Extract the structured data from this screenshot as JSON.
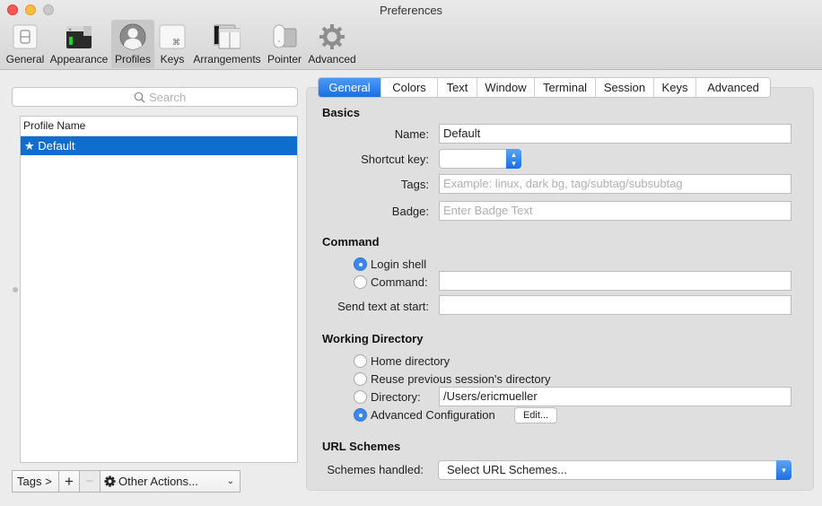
{
  "window": {
    "title": "Preferences"
  },
  "toolbar": {
    "items": [
      {
        "label": "General",
        "icon": "toggle-switch-icon"
      },
      {
        "label": "Appearance",
        "icon": "terminal-window-icon"
      },
      {
        "label": "Profiles",
        "icon": "user-silhouette-icon",
        "active": true
      },
      {
        "label": "Keys",
        "icon": "command-key-icon"
      },
      {
        "label": "Arrangements",
        "icon": "window-arrangement-icon"
      },
      {
        "label": "Pointer",
        "icon": "mouse-icon"
      },
      {
        "label": "Advanced",
        "icon": "gear-icon"
      }
    ]
  },
  "sidebar": {
    "search_placeholder": "Search",
    "table_header": "Profile Name",
    "profiles": [
      {
        "name": "★ Default",
        "selected": true
      }
    ],
    "bottom": {
      "tags_label": "Tags >",
      "add_label": "+",
      "remove_label": "−",
      "actions_label": "Other Actions...",
      "actions_chevron": "⌄"
    }
  },
  "tabs": [
    {
      "label": "General",
      "active": true
    },
    {
      "label": "Colors"
    },
    {
      "label": "Text"
    },
    {
      "label": "Window"
    },
    {
      "label": "Terminal"
    },
    {
      "label": "Session"
    },
    {
      "label": "Keys"
    },
    {
      "label": "Advanced"
    }
  ],
  "basics": {
    "heading": "Basics",
    "name_label": "Name:",
    "name_value": "Default",
    "shortcut_label": "Shortcut key:",
    "shortcut_value": "",
    "tags_label": "Tags:",
    "tags_placeholder": "Example: linux, dark bg, tag/subtag/subsubtag",
    "badge_label": "Badge:",
    "badge_placeholder": "Enter Badge Text"
  },
  "command": {
    "heading": "Command",
    "login_shell_label": "Login shell",
    "login_shell_selected": true,
    "command_label": "Command:",
    "command_selected": false,
    "command_value": "",
    "send_text_label": "Send text at start:",
    "send_text_value": ""
  },
  "working_directory": {
    "heading": "Working Directory",
    "options": [
      {
        "label": "Home directory",
        "selected": false
      },
      {
        "label": "Reuse previous session's directory",
        "selected": false
      },
      {
        "label": "Directory:",
        "selected": false
      },
      {
        "label": "Advanced Configuration",
        "selected": true
      }
    ],
    "directory_value": "/Users/ericmueller",
    "edit_label": "Edit..."
  },
  "url_schemes": {
    "heading": "URL Schemes",
    "schemes_label": "Schemes handled:",
    "schemes_value": "Select URL Schemes..."
  },
  "colors": {
    "accent": "#1a6fe6",
    "selection": "#0f6ecd",
    "close": "#fc5753",
    "minimize": "#fdbc40"
  }
}
